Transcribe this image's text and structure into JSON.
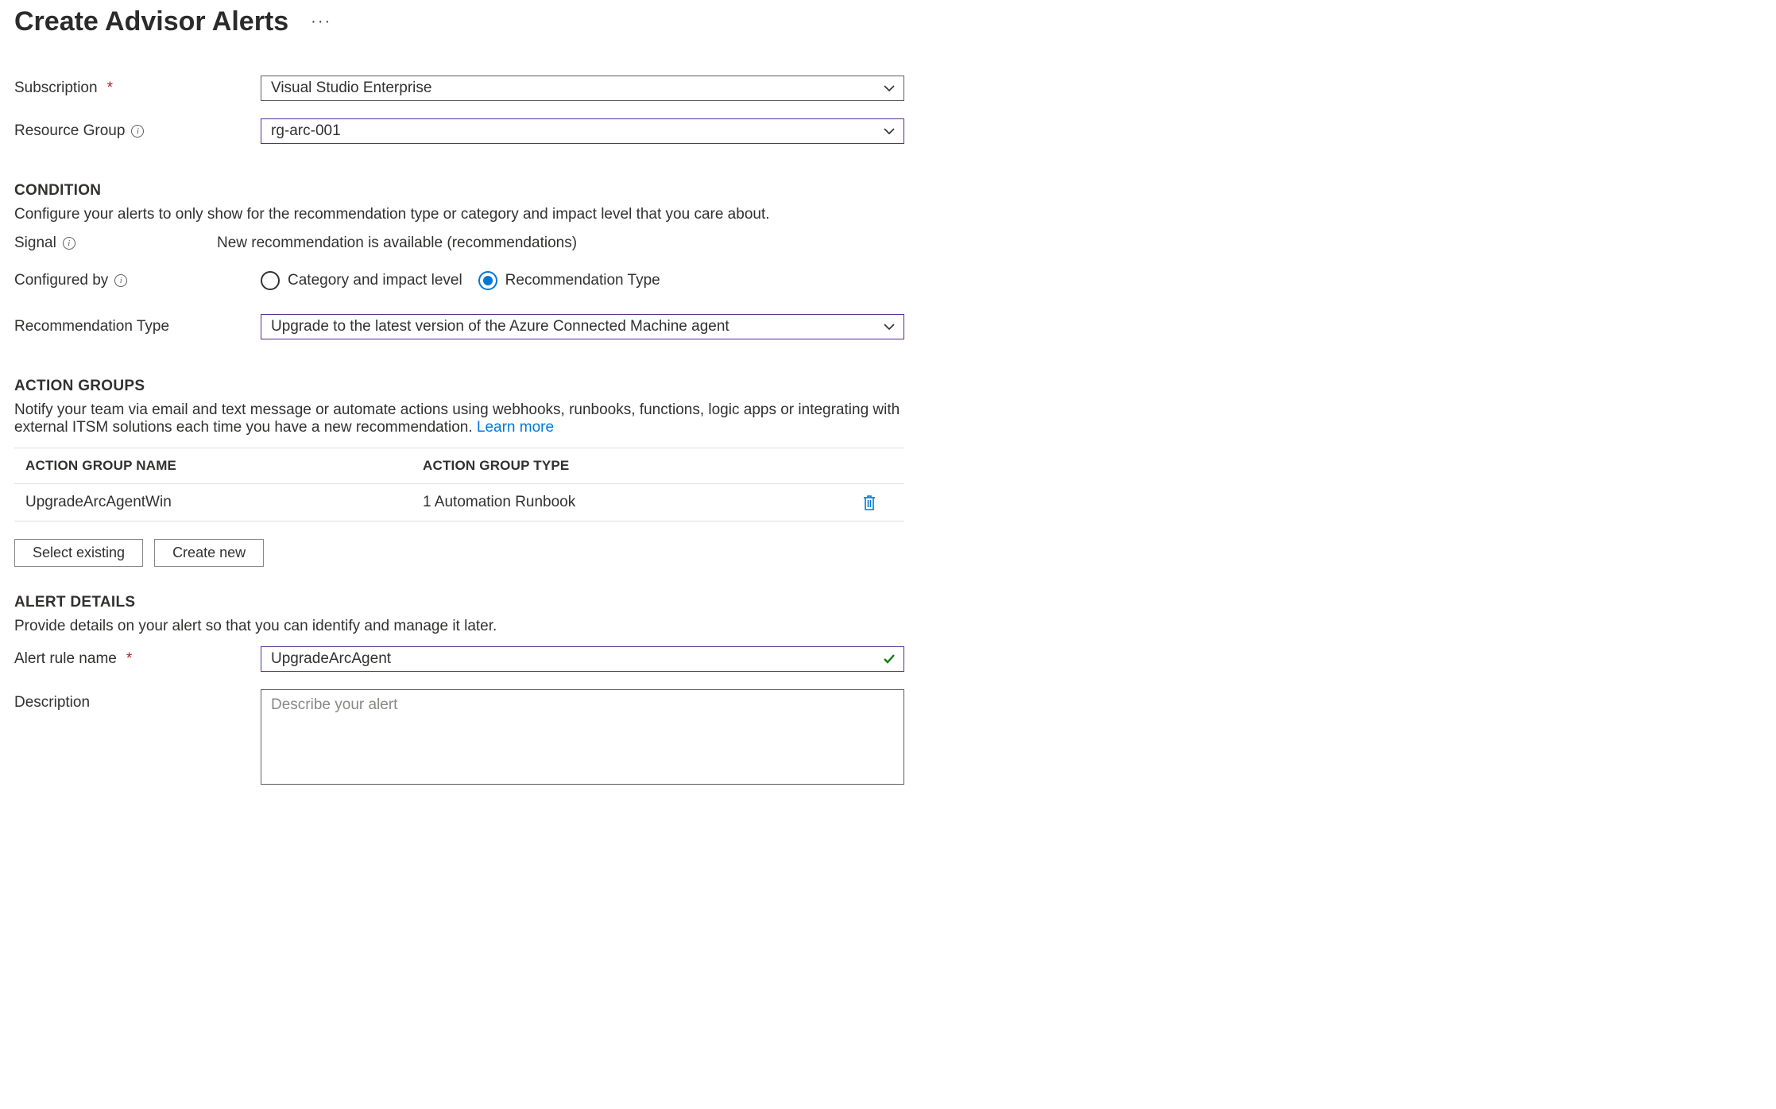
{
  "header": {
    "title": "Create Advisor Alerts"
  },
  "fields": {
    "subscription_label": "Subscription",
    "subscription_value": "Visual Studio Enterprise",
    "resource_group_label": "Resource Group",
    "resource_group_value": "rg-arc-001"
  },
  "condition": {
    "heading": "CONDITION",
    "desc": "Configure your alerts to only show for the recommendation type or category and impact level that you care about.",
    "signal_label": "Signal",
    "signal_value": "New recommendation is available (recommendations)",
    "configured_by_label": "Configured by",
    "radio_category": "Category and impact level",
    "radio_rectype": "Recommendation Type",
    "rec_type_label": "Recommendation Type",
    "rec_type_value": "Upgrade to the latest version of the Azure Connected Machine agent"
  },
  "action_groups": {
    "heading": "ACTION GROUPS",
    "desc_pre": "Notify your team via email and text message or automate actions using webhooks, runbooks, functions, logic apps or integrating with external ITSM solutions each time you have a new recommendation. ",
    "learn_more": "Learn more",
    "col_name": "ACTION GROUP NAME",
    "col_type": "ACTION GROUP TYPE",
    "rows": [
      {
        "name": "UpgradeArcAgentWin",
        "type": "1 Automation Runbook"
      }
    ],
    "btn_select_existing": "Select existing",
    "btn_create_new": "Create new"
  },
  "alert_details": {
    "heading": "ALERT DETAILS",
    "desc": "Provide details on your alert so that you can identify and manage it later.",
    "rule_name_label": "Alert rule name",
    "rule_name_value": "UpgradeArcAgent",
    "description_label": "Description",
    "description_placeholder": "Describe your alert"
  }
}
